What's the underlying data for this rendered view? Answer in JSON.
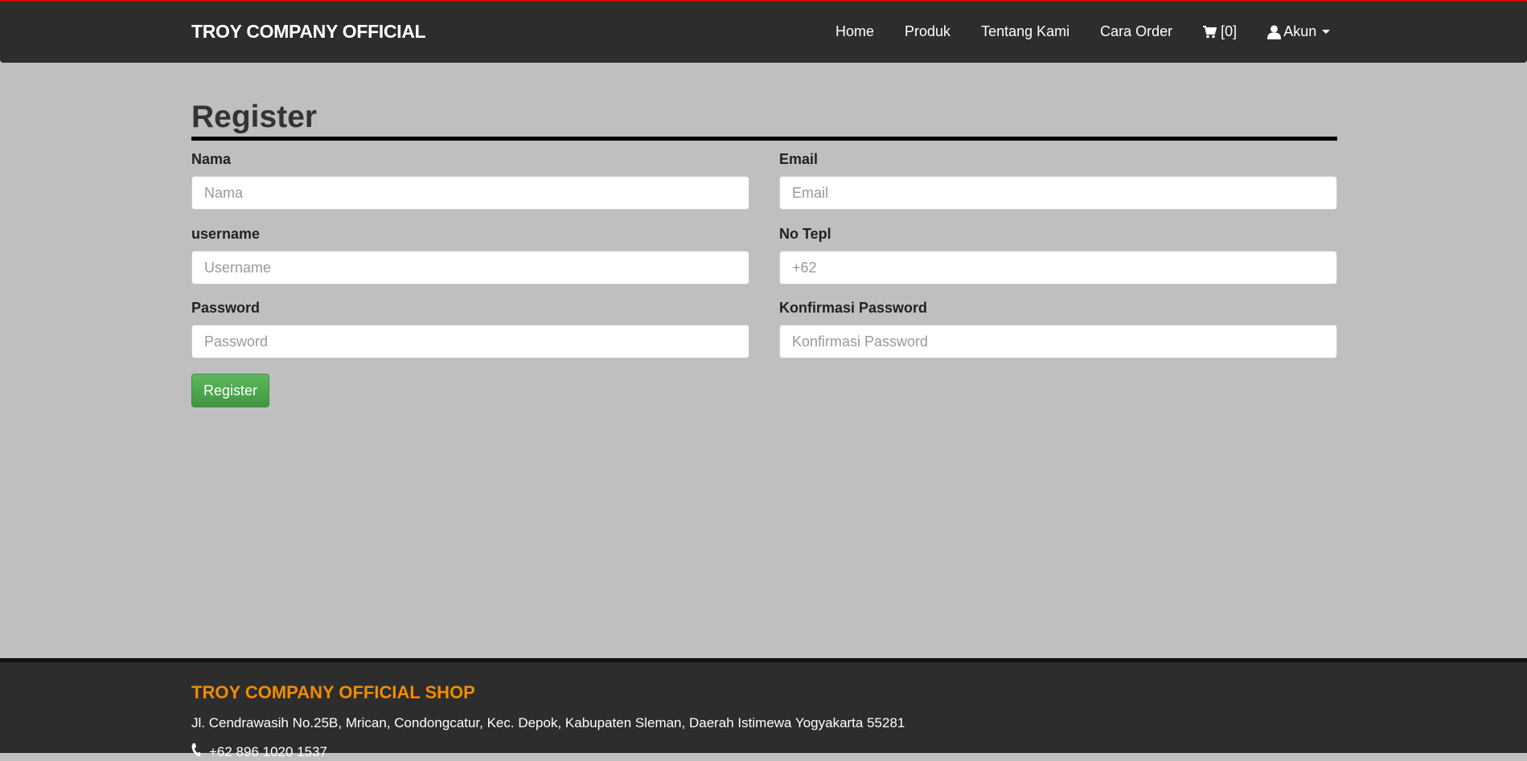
{
  "navbar": {
    "brand": "TROY COMPANY OFFICIAL",
    "links": [
      {
        "label": "Home"
      },
      {
        "label": "Produk"
      },
      {
        "label": "Tentang Kami"
      },
      {
        "label": "Cara Order"
      }
    ],
    "cart": {
      "icon": "cart-icon",
      "count_label": "[0]"
    },
    "account": {
      "icon": "user-icon",
      "label": "Akun"
    }
  },
  "form": {
    "title": "Register",
    "fields": {
      "nama": {
        "label": "Nama",
        "placeholder": "Nama",
        "value": ""
      },
      "email": {
        "label": "Email",
        "placeholder": "Email",
        "value": ""
      },
      "username": {
        "label": "username",
        "placeholder": "Username",
        "value": ""
      },
      "phone": {
        "label": "No Tepl",
        "placeholder": "+62",
        "value": ""
      },
      "password": {
        "label": "Password",
        "placeholder": "Password",
        "value": ""
      },
      "confirm_password": {
        "label": "Konfirmasi Password",
        "placeholder": "Konfirmasi Password",
        "value": ""
      }
    },
    "submit_label": "Register"
  },
  "footer": {
    "title": "TROY COMPANY OFFICIAL SHOP",
    "address": "Jl. Cendrawasih No.25B, Mrican, Condongcatur, Kec. Depok, Kabupaten Sleman, Daerah Istimewa Yogyakarta 55281",
    "phone": "+62 896 1020 1537",
    "phone_icon": "phone-icon"
  },
  "colors": {
    "top_accent": "#e00000",
    "navbar_bg": "#2d2d2d",
    "page_bg": "#bfbfbf",
    "button_green": "#4cae4c",
    "footer_title": "#f08c00"
  }
}
